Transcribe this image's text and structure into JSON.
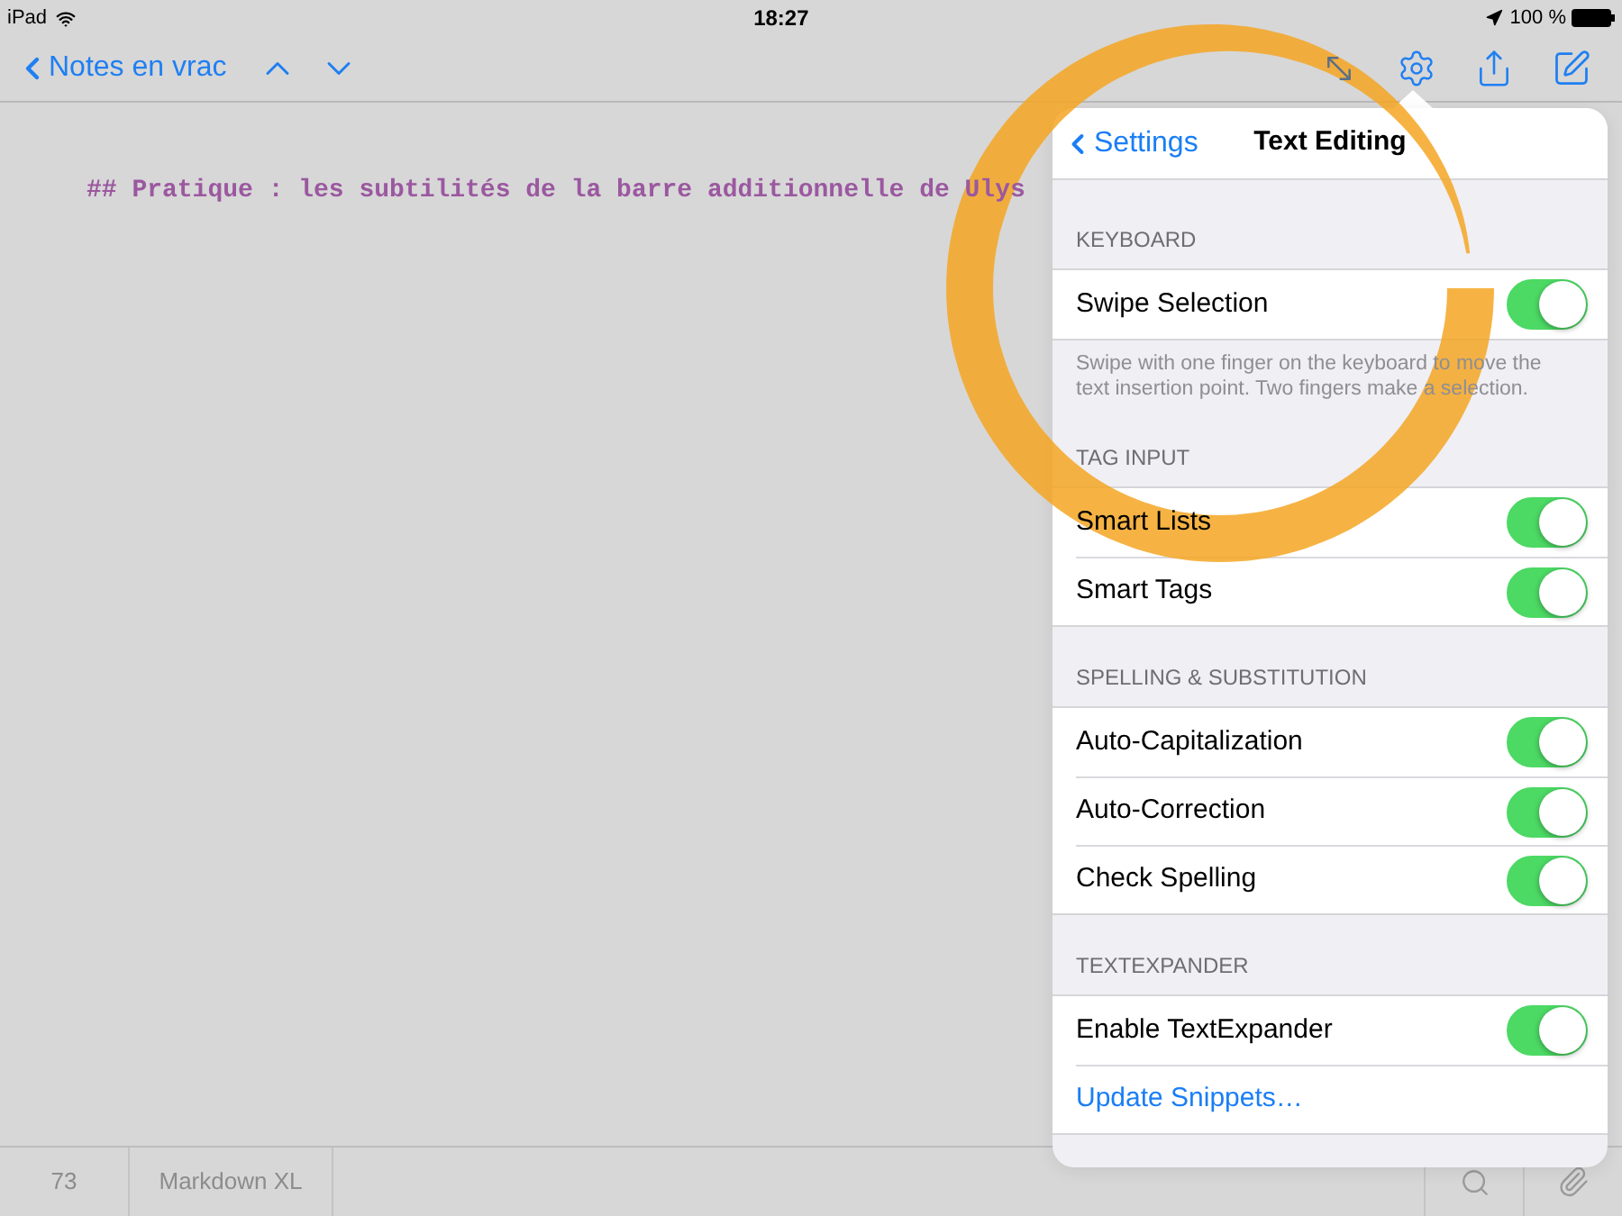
{
  "status_bar": {
    "device": "iPad",
    "time": "18:27",
    "battery": "100 %"
  },
  "toolbar": {
    "back": "Notes en vrac"
  },
  "editor": {
    "heading": "## Pratique : les subtilités de la barre additionnelle de Ulys"
  },
  "popover": {
    "back": "Settings",
    "title": "Text Editing",
    "sections": [
      {
        "header": "KEYBOARD",
        "rows": [
          {
            "kind": "toggle",
            "label": "Swipe Selection",
            "on": true
          }
        ],
        "footer": "Swipe with one finger on the keyboard to move the text insertion point. Two fingers make a selection."
      },
      {
        "header": "TAG INPUT",
        "rows": [
          {
            "kind": "toggle",
            "label": "Smart Lists",
            "on": true
          },
          {
            "kind": "toggle",
            "label": "Smart Tags",
            "on": true
          }
        ]
      },
      {
        "header": "SPELLING & SUBSTITUTION",
        "rows": [
          {
            "kind": "toggle",
            "label": "Auto-Capitalization",
            "on": true
          },
          {
            "kind": "toggle",
            "label": "Auto-Correction",
            "on": true
          },
          {
            "kind": "toggle",
            "label": "Check Spelling",
            "on": true
          }
        ]
      },
      {
        "header": "TEXTEXPANDER",
        "rows": [
          {
            "kind": "toggle",
            "label": "Enable TextExpander",
            "on": true
          },
          {
            "kind": "link",
            "label": "Update Snippets…"
          }
        ]
      }
    ]
  },
  "bottom_bar": {
    "count": "73",
    "mode": "Markdown XL"
  }
}
